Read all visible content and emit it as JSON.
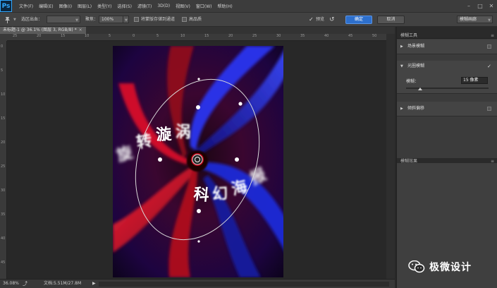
{
  "app": {
    "logo": "Ps"
  },
  "menu": [
    "文件(F)",
    "编辑(E)",
    "图像(I)",
    "图层(L)",
    "类型(Y)",
    "选择(S)",
    "滤镜(T)",
    "3D(D)",
    "视图(V)",
    "窗口(W)",
    "帮助(H)"
  ],
  "options": {
    "selection_label": "选区出血：",
    "focus_label": "聚焦：",
    "focus_value": "100%",
    "save_mask_label": "将蒙版存储到通道",
    "high_quality_label": "高品质",
    "preview_label": "预览",
    "ok_label": "确定",
    "cancel_label": "取消",
    "workspace_select": "模糊画廊"
  },
  "document": {
    "tab_title": "未标题-1 @ 36.1% (图层 3, RGB/8) *",
    "close_glyph": "×",
    "zoom": "36.08%",
    "doc_size": "文档:5.51M/27.8M"
  },
  "rulers": {
    "h_ticks": [
      "25",
      "20",
      "15",
      "10",
      "5",
      "0",
      "5",
      "10",
      "15",
      "20",
      "25",
      "30",
      "35",
      "40",
      "45",
      "50"
    ],
    "v_ticks": [
      "0",
      "5",
      "10",
      "15",
      "20",
      "25",
      "30",
      "35",
      "40",
      "45"
    ]
  },
  "canvas_text": {
    "phrase1": [
      "旋",
      "转",
      "漩",
      "涡"
    ],
    "phrase2": [
      "科",
      "幻",
      "海",
      "报"
    ]
  },
  "panel": {
    "blur_tools_header": "模糊工具",
    "field_blur": "场景模糊",
    "iris_blur": "光圈模糊",
    "blur_label": "模糊：",
    "blur_value": "15 像素",
    "blur_fraction": 0.17,
    "tilt_shift": "倾斜偏移",
    "blur_effects_header": "模糊效果"
  },
  "watermark": "极微设计",
  "colors": {
    "accent": "#2d6fcc",
    "red": "#e0102a",
    "blue": "#1a2ee8"
  }
}
